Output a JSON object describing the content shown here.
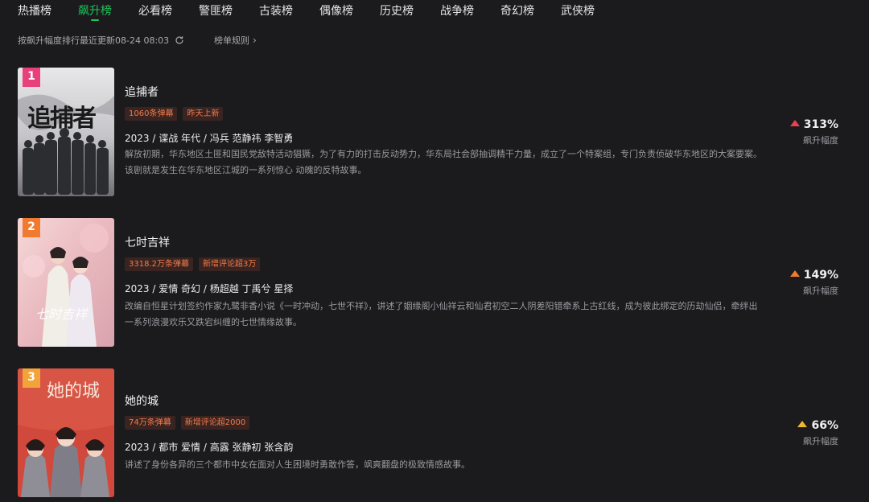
{
  "tabs": [
    {
      "label": "热播榜",
      "active": false
    },
    {
      "label": "飙升榜",
      "active": true
    },
    {
      "label": "必看榜",
      "active": false
    },
    {
      "label": "警匪榜",
      "active": false
    },
    {
      "label": "古装榜",
      "active": false
    },
    {
      "label": "偶像榜",
      "active": false
    },
    {
      "label": "历史榜",
      "active": false
    },
    {
      "label": "战争榜",
      "active": false
    },
    {
      "label": "奇幻榜",
      "active": false
    },
    {
      "label": "武侠榜",
      "active": false
    }
  ],
  "subbar": {
    "update_text": "按飙升幅度排行最近更新08-24 08:03",
    "rules_label": "榜单规则"
  },
  "items": [
    {
      "rank": "1",
      "rank_color": "#e8417a",
      "title": "追捕者",
      "poster_text": "追捕者",
      "tags": [
        "1060条弹幕",
        "昨天上新"
      ],
      "meta": "2023 / 谍战 年代 / 冯兵 范静祎 李智勇",
      "desc": "解放初期，华东地区土匪和国民党敌特活动猖獗，为了有力的打击反动势力，华东局社会部抽调精干力量，成立了一个特案组，专门负责侦破华东地区的大案要案。该剧就是发生在华东地区江城的一系列惊心 动魄的反特故事。",
      "rise_pct": "313%",
      "rise_label": "飙升幅度",
      "rise_color": "#e8414f"
    },
    {
      "rank": "2",
      "rank_color": "#f07a2e",
      "title": "七时吉祥",
      "poster_text": "七时吉祥",
      "tags": [
        "3318.2万条弹幕",
        "新增评论超3万"
      ],
      "meta": "2023 / 爱情 奇幻 / 杨超越 丁禹兮 星择",
      "desc": "改编自恒星计划签约作家九鹭非香小说《一时冲动，七世不祥》，讲述了姻缘阁小仙祥云和仙君初空二人阴差阳错牵系上古红线，成为彼此绑定的历劫仙侣，牵绊出一系列浪漫欢乐又跌宕纠缠的七世情缘故事。",
      "rise_pct": "149%",
      "rise_label": "飙升幅度",
      "rise_color": "#f07a2e"
    },
    {
      "rank": "3",
      "rank_color": "#f2a33a",
      "title": "她的城",
      "poster_text": "她的城",
      "tags": [
        "74万条弹幕",
        "新增评论超2000"
      ],
      "meta": "2023 / 都市 爱情 / 高露 张静初 张含韵",
      "desc": "讲述了身份各异的三个都市中女在面对人生困境时勇敢作答，飒爽翻盘的极致情感故事。",
      "rise_pct": "66%",
      "rise_label": "飙升幅度",
      "rise_color": "#f2b52e"
    }
  ]
}
